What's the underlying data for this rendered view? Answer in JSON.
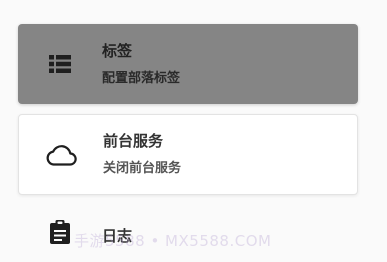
{
  "menu": {
    "items": [
      {
        "title": "标签",
        "subtitle": "配置部落标签",
        "icon": "list-icon",
        "selected": true
      },
      {
        "title": "前台服务",
        "subtitle": "关闭前台服务",
        "icon": "cloud-icon",
        "selected": false
      },
      {
        "title": "日志",
        "subtitle": "",
        "icon": "clipboard-icon",
        "selected": false
      }
    ]
  },
  "watermark": {
    "text": "手游5588 • MX5588.COM"
  },
  "colors": {
    "selected_background": "#858585",
    "card_background": "#ffffff",
    "page_background": "#fafafa",
    "icon_color": "#222222"
  }
}
